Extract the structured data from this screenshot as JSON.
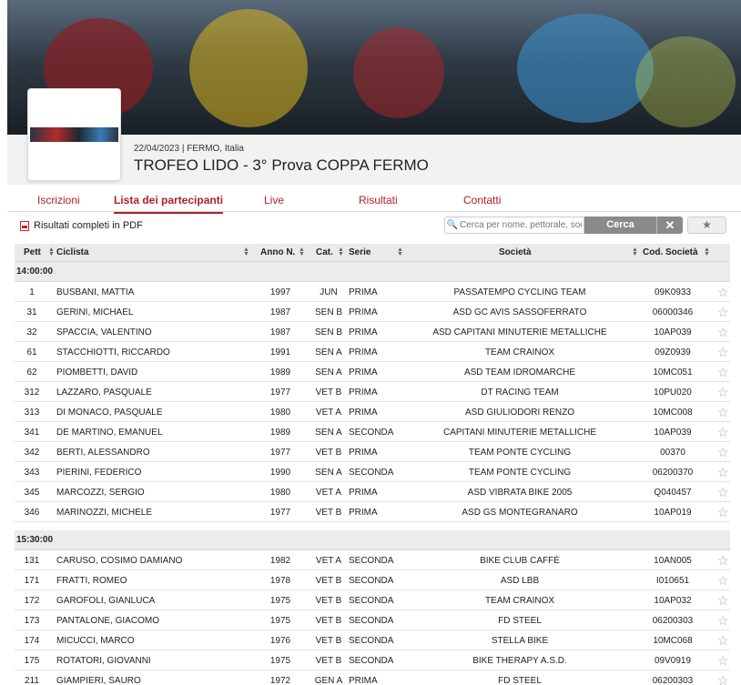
{
  "event": {
    "date_location": "22/04/2023 | FERMO, Italia",
    "title": "TROFEO LIDO - 3° Prova COPPA FERMO"
  },
  "tabs": [
    "Iscrizioni",
    "Lista dei partecipanti",
    "Live",
    "Risultati",
    "Contatti"
  ],
  "active_tab": 1,
  "toolbar": {
    "pdf_label": "Risultati completi in PDF",
    "search_placeholder": "Cerca per nome, pettorale, società",
    "search_button": "Cerca",
    "clear_icon": "✕",
    "favorites_icon": "★"
  },
  "colors": {
    "accent": "#b0202a",
    "header_bg": "#eaeaea",
    "button_gray": "#8a8a8a"
  },
  "table": {
    "columns": [
      "Pett",
      "Ciclista",
      "Anno N.",
      "Cat.",
      "Serie",
      "Società",
      "Cod. Società"
    ],
    "groups": [
      {
        "time": "14:00:00",
        "rows": [
          [
            "1",
            "BUSBANI, MATTIA",
            "1997",
            "JUN",
            "PRIMA",
            "PASSATEMPO CYCLING TEAM",
            "09K0933"
          ],
          [
            "31",
            "GERINI, MICHAEL",
            "1987",
            "SEN B",
            "PRIMA",
            "ASD GC AVIS SASSOFERRATO",
            "06000346"
          ],
          [
            "32",
            "SPACCIA, VALENTINO",
            "1987",
            "SEN B",
            "PRIMA",
            "ASD CAPITANI MINUTERIE METALLICHE",
            "10AP039"
          ],
          [
            "61",
            "STACCHIOTTI, RICCARDO",
            "1991",
            "SEN A",
            "PRIMA",
            "TEAM CRAINOX",
            "09Z0939"
          ],
          [
            "62",
            "PIOMBETTI, DAVID",
            "1989",
            "SEN A",
            "PRIMA",
            "ASD TEAM IDROMARCHE",
            "10MC051"
          ],
          [
            "312",
            "LAZZARO, PASQUALE",
            "1977",
            "VET B",
            "PRIMA",
            "DT RACING TEAM",
            "10PU020"
          ],
          [
            "313",
            "DI MONACO, PASQUALE",
            "1980",
            "VET A",
            "PRIMA",
            "ASD GIULIODORI RENZO",
            "10MC008"
          ],
          [
            "341",
            "DE MARTINO, EMANUEL",
            "1989",
            "SEN A",
            "SECONDA",
            "CAPITANI MINUTERIE METALLICHE",
            "10AP039"
          ],
          [
            "342",
            "BERTI, ALESSANDRO",
            "1977",
            "VET B",
            "PRIMA",
            "TEAM PONTE CYCLING",
            "00370"
          ],
          [
            "343",
            "PIERINI, FEDERICO",
            "1990",
            "SEN A",
            "SECONDA",
            "TEAM PONTE CYCLING",
            "06200370"
          ],
          [
            "345",
            "MARCOZZI, SERGIO",
            "1980",
            "VET A",
            "PRIMA",
            "ASD VIBRATA BIKE 2005",
            "Q040457"
          ],
          [
            "346",
            "MARINOZZI, MICHELE",
            "1977",
            "VET B",
            "PRIMA",
            "ASD GS MONTEGRANARO",
            "10AP019"
          ]
        ]
      },
      {
        "time": "15:30:00",
        "rows": [
          [
            "131",
            "CARUSO, COSIMO DAMIANO",
            "1982",
            "VET A",
            "SECONDA",
            "BIKE CLUB CAFFÈ",
            "10AN005"
          ],
          [
            "171",
            "FRATTI, ROMEO",
            "1978",
            "VET B",
            "SECONDA",
            "ASD LBB",
            "I010651"
          ],
          [
            "172",
            "GAROFOLI, GIANLUCA",
            "1975",
            "VET B",
            "SECONDA",
            "TEAM CRAINOX",
            "10AP032"
          ],
          [
            "173",
            "PANTALONE, GIACOMO",
            "1975",
            "VET B",
            "SECONDA",
            "FD STEEL",
            "06200303"
          ],
          [
            "174",
            "MICUCCI, MARCO",
            "1976",
            "VET B",
            "SECONDA",
            "STELLA BIKE",
            "10MC068"
          ],
          [
            "175",
            "ROTATORI, GIOVANNI",
            "1975",
            "VET B",
            "SECONDA",
            "BIKE THERAPY A.S.D.",
            "09V0919"
          ],
          [
            "211",
            "GIAMPIERI, SAURO",
            "1972",
            "GEN A",
            "PRIMA",
            "FD STEEL",
            "06200303"
          ]
        ]
      }
    ]
  }
}
